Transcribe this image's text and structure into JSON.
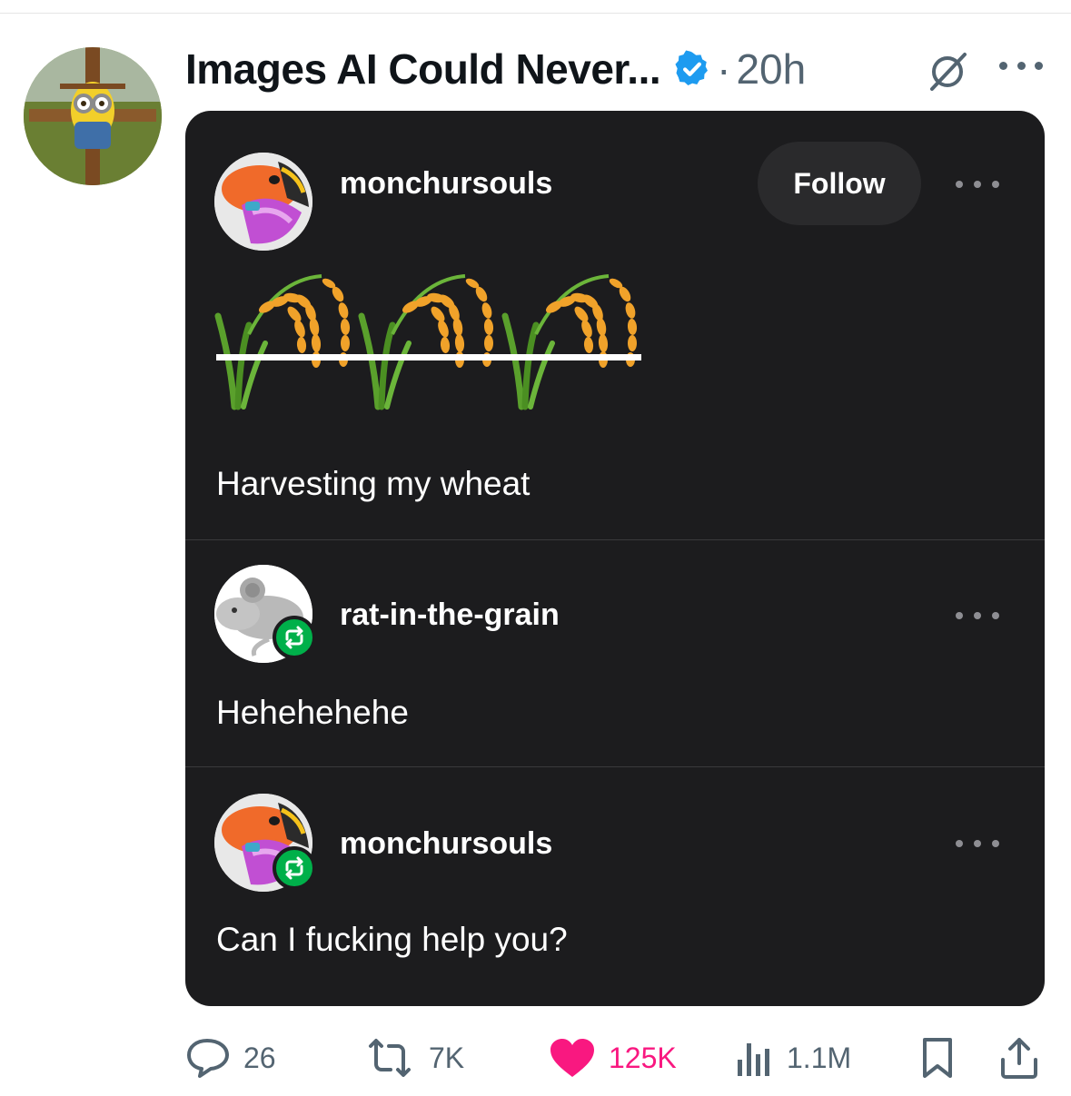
{
  "tweet": {
    "author_name": "Images AI Could Never...",
    "separator": "·",
    "time": "20h",
    "verified": true
  },
  "embedded_post": {
    "entries": [
      {
        "username": "monchursouls",
        "text": "Harvesting my wheat",
        "follow_label": "Follow"
      },
      {
        "username": "rat-in-the-grain",
        "text": "Hehehehehe"
      },
      {
        "username": "monchursouls",
        "text": "Can I fucking help you?"
      }
    ]
  },
  "actions": {
    "replies": "26",
    "reposts": "7K",
    "likes": "125K",
    "views": "1.1M"
  },
  "colors": {
    "verified": "#1d9bf0",
    "like": "#f91880",
    "reblog": "#00b04a",
    "card_bg": "#1c1c1e"
  },
  "icons": [
    "verified-badge-icon",
    "grok-icon",
    "more-icon",
    "reply-icon",
    "repost-icon",
    "heart-icon",
    "views-icon",
    "bookmark-icon",
    "share-icon",
    "reblog-icon",
    "wheat-emoji-icon"
  ]
}
